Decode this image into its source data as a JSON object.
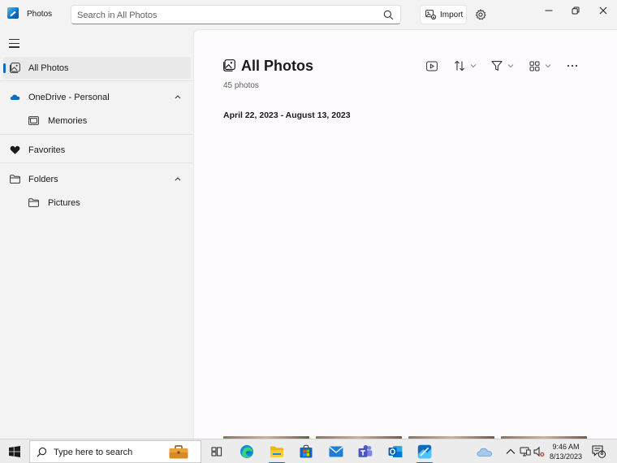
{
  "app": {
    "title": "Photos"
  },
  "search": {
    "placeholder": "Search in All Photos"
  },
  "toolbar": {
    "import_label": "Import"
  },
  "sidebar": {
    "items": [
      {
        "label": "All Photos"
      },
      {
        "label": "OneDrive - Personal"
      },
      {
        "label": "Memories"
      },
      {
        "label": "Favorites"
      },
      {
        "label": "Folders"
      },
      {
        "label": "Pictures"
      }
    ]
  },
  "main": {
    "title": "All Photos",
    "count": "45 photos",
    "date_range": "April 22, 2023 - August 13, 2023"
  },
  "taskbar": {
    "search_text": "Type here to search",
    "time": "9:46 AM",
    "date": "8/13/2023",
    "notification_count": "8"
  },
  "colors": {
    "accent": "#0f6cbd",
    "main_bg": "#fdfbfd",
    "sidebar_bg": "#f3f3f3"
  }
}
